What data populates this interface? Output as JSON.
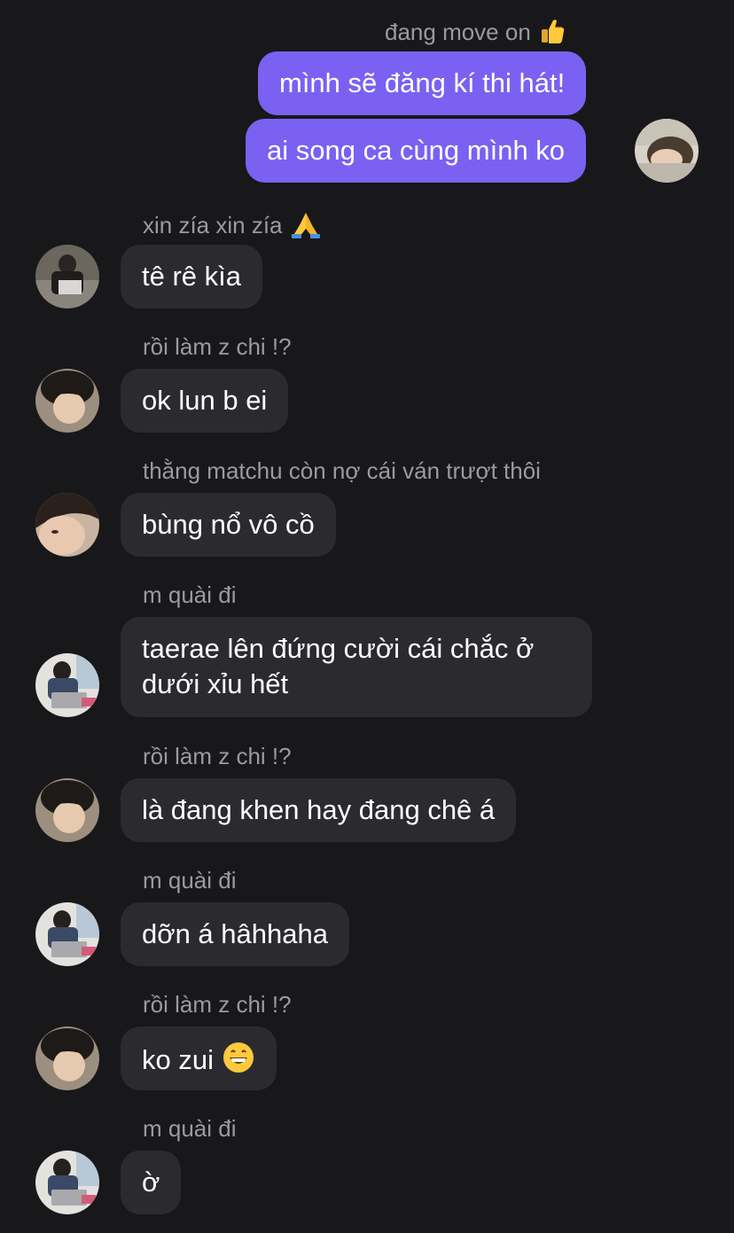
{
  "colors": {
    "background": "#18181a",
    "incoming_bubble": "#2b2b2f",
    "outgoing_bubble": "#7a61f2",
    "name_text": "#9a9aa0",
    "message_text": "#ffffff"
  },
  "outgoing": {
    "sender_name": "đang move on",
    "sender_emoji": "thumbs-up",
    "messages": [
      "mình sẽ đăng kí thi hát!",
      "ai song ca cùng mình ko"
    ]
  },
  "incoming": [
    {
      "name": "xin zía xin zía",
      "name_emoji": "folded-hands",
      "text": "tê rê kìa",
      "avatar": "avatar-person-laptop-dark"
    },
    {
      "name": "rồi làm z chi !?",
      "text": "ok lun b ei",
      "avatar": "avatar-boy-dark-hair"
    },
    {
      "name": "thằng matchu còn nợ cái ván trượt thôi",
      "text": "bùng nổ vô cồ",
      "avatar": "avatar-face-closeup"
    },
    {
      "name": "m quài đi",
      "text": "taerae lên đứng cười cái chắc ở dưới xỉu hết",
      "avatar": "avatar-person-laptop-light"
    },
    {
      "name": "rồi làm z chi !?",
      "text": "là đang khen hay đang chê á",
      "avatar": "avatar-boy-dark-hair"
    },
    {
      "name": "m quài đi",
      "text": "dỡn á hâhhaha",
      "avatar": "avatar-person-laptop-light"
    },
    {
      "name": "rồi làm z chi !?",
      "text": "ko zui",
      "text_emoji": "grinning-face",
      "avatar": "avatar-boy-dark-hair"
    },
    {
      "name": "m quài đi",
      "text": "ờ",
      "avatar": "avatar-person-laptop-light"
    }
  ]
}
